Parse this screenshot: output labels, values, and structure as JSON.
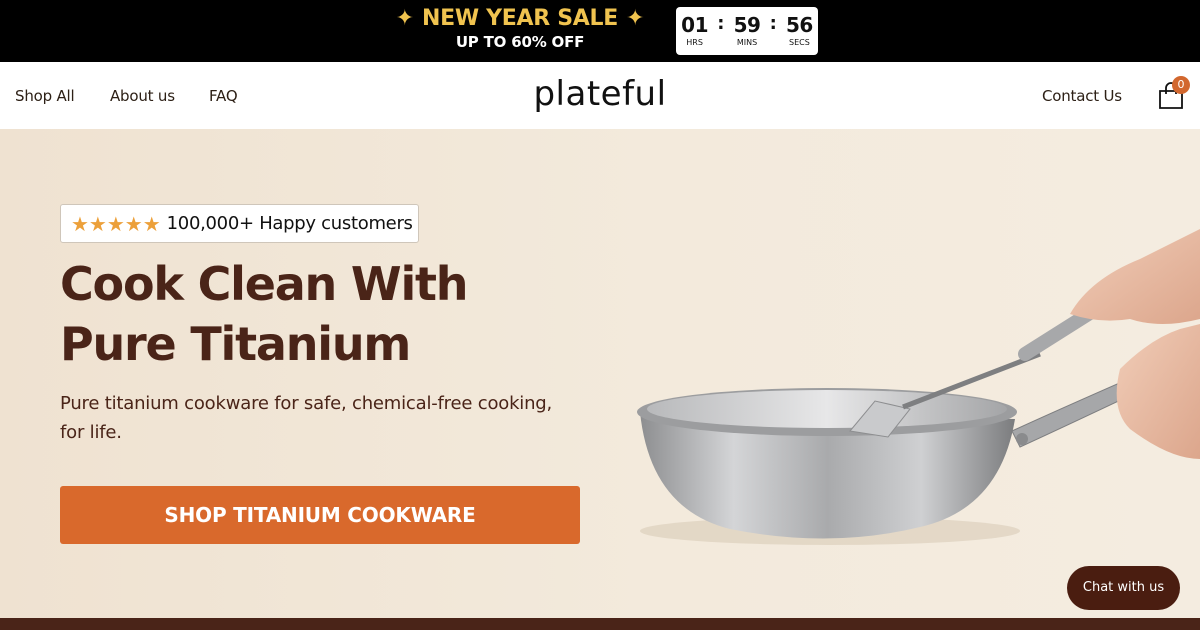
{
  "promo": {
    "sparkle_left": "✦",
    "sparkle_right": "✦",
    "title": "NEW YEAR SALE",
    "subtitle": "UP TO 60% OFF",
    "countdown": {
      "hours": "01",
      "hours_label": "HRS",
      "minutes": "59",
      "minutes_label": "MINS",
      "seconds": "56",
      "seconds_label": "SECS",
      "separator": ":"
    },
    "title_color": "#f0c34f"
  },
  "header": {
    "nav_left": [
      "Shop All",
      "About us",
      "FAQ"
    ],
    "logo": "plateful",
    "contact": "Contact Us",
    "cart_count": "0",
    "cart_icon": "shopping-bag-icon"
  },
  "hero": {
    "stars": "★★★★★",
    "rating_text": "100,000+ Happy customers",
    "title": "Cook Clean With Pure Titanium",
    "subtitle": "Pure titanium cookware for safe, chemical-free cooking, for life.",
    "cta": "SHOP TITANIUM COOKWARE"
  },
  "chat": {
    "label": "Chat with us"
  },
  "colors": {
    "brand_brown": "#4a2418",
    "cta_orange": "#d9692c",
    "promo_gold": "#f0c34f",
    "hero_bg": "#f1e7d9"
  }
}
